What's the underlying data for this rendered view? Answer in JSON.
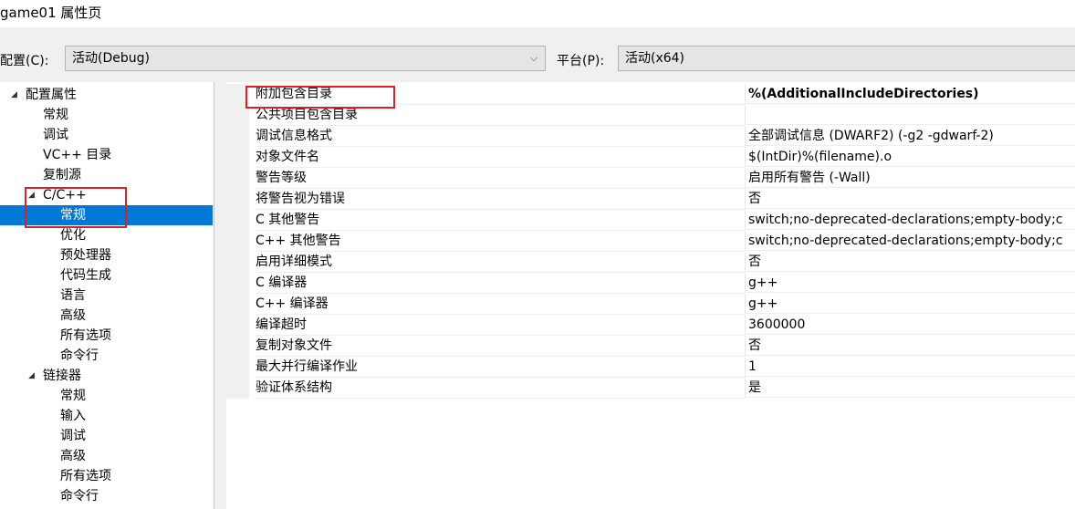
{
  "window": {
    "title": "game01 属性页"
  },
  "config": {
    "config_label": "配置(C):",
    "config_value": "活动(Debug)",
    "platform_label": "平台(P):",
    "platform_value": "活动(x64)"
  },
  "tree": {
    "root": "配置属性",
    "items": [
      {
        "label": "常规"
      },
      {
        "label": "调试"
      },
      {
        "label": "VC++ 目录"
      },
      {
        "label": "复制源"
      }
    ],
    "cpp": {
      "label": "C/C++",
      "children": [
        {
          "label": "常规"
        },
        {
          "label": "优化"
        },
        {
          "label": "预处理器"
        },
        {
          "label": "代码生成"
        },
        {
          "label": "语言"
        },
        {
          "label": "高级"
        },
        {
          "label": "所有选项"
        },
        {
          "label": "命令行"
        }
      ]
    },
    "linker": {
      "label": "链接器",
      "children": [
        {
          "label": "常规"
        },
        {
          "label": "输入"
        },
        {
          "label": "调试"
        },
        {
          "label": "高级"
        },
        {
          "label": "所有选项"
        },
        {
          "label": "命令行"
        }
      ]
    }
  },
  "properties": [
    {
      "name": "附加包含目录",
      "value": "%(AdditionalIncludeDirectories)"
    },
    {
      "name": "公共项目包含目录",
      "value": ""
    },
    {
      "name": "调试信息格式",
      "value": "全部调试信息 (DWARF2) (-g2 -gdwarf-2)"
    },
    {
      "name": "对象文件名",
      "value": "$(IntDir)%(filename).o"
    },
    {
      "name": "警告等级",
      "value": "启用所有警告 (-Wall)"
    },
    {
      "name": "将警告视为错误",
      "value": "否"
    },
    {
      "name": "C 其他警告",
      "value": "switch;no-deprecated-declarations;empty-body;c"
    },
    {
      "name": "C++ 其他警告",
      "value": "switch;no-deprecated-declarations;empty-body;c"
    },
    {
      "name": "启用详细模式",
      "value": "否"
    },
    {
      "name": "C 编译器",
      "value": "g++"
    },
    {
      "name": "C++ 编译器",
      "value": "g++"
    },
    {
      "name": "编译超时",
      "value": "3600000"
    },
    {
      "name": "复制对象文件",
      "value": "否"
    },
    {
      "name": "最大并行编译作业",
      "value": "1"
    },
    {
      "name": "验证体系结构",
      "value": "是"
    }
  ],
  "colors": {
    "selection": "#0078d7",
    "highlight_box": "#e02020"
  }
}
